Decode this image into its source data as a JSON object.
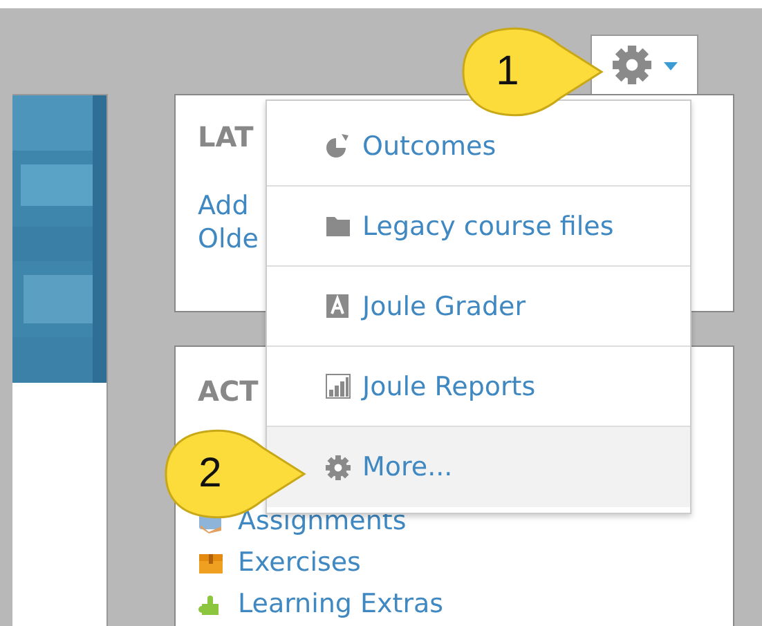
{
  "settings_button": {
    "expanded": true
  },
  "settings_menu": [
    {
      "label": "Outcomes",
      "selected": false
    },
    {
      "label": "Legacy course files",
      "selected": false
    },
    {
      "label": "Joule Grader",
      "selected": false
    },
    {
      "label": "Joule Reports",
      "selected": false
    },
    {
      "label": "More...",
      "selected": true
    }
  ],
  "blocks": [
    {
      "title": "LAT",
      "links": [
        "Add",
        "Olde"
      ]
    },
    {
      "title": "ACT",
      "links": [
        "Assignments",
        "Exercises",
        "Learning Extras"
      ]
    }
  ],
  "callouts": [
    {
      "label": "1"
    },
    {
      "label": "2"
    }
  ]
}
